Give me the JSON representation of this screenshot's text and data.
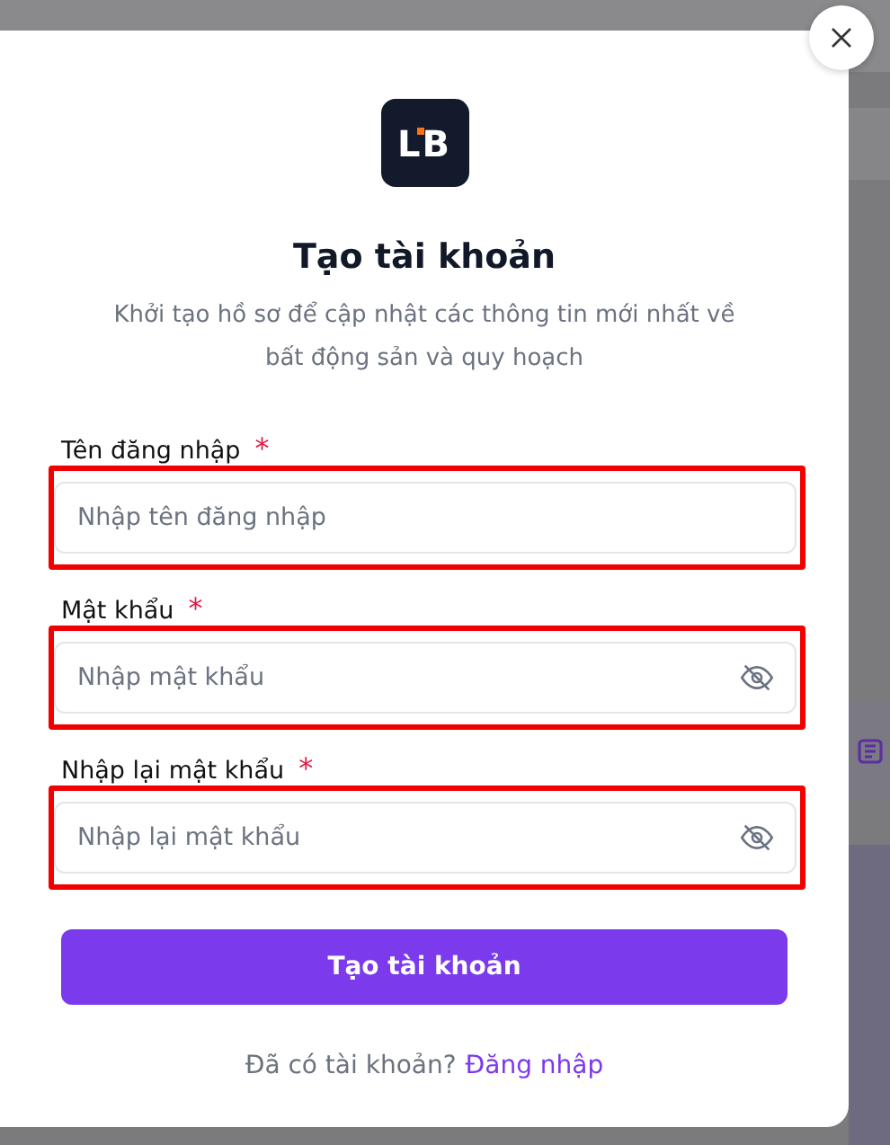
{
  "dialog": {
    "logo": "LB",
    "title": "Tạo tài khoản",
    "subtitle": "Khởi tạo hồ sơ để cập nhật các thông tin mới nhất về bất động sản và quy hoạch",
    "fields": [
      {
        "label": "Tên đăng nhập",
        "required_mark": "*",
        "placeholder": "Nhập tên đăng nhập",
        "kind": "text",
        "highlighted": true
      },
      {
        "label": "Mật khẩu",
        "required_mark": "*",
        "placeholder": "Nhập mật khẩu",
        "kind": "password",
        "highlighted": true
      },
      {
        "label": "Nhập lại mật khẩu",
        "required_mark": "*",
        "placeholder": "Nhập lại mật khẩu",
        "kind": "password",
        "highlighted": true
      }
    ],
    "submit": "Tạo tài khoản",
    "footer_text": "Đã có tài khoản?",
    "footer_link": "Đăng nhập"
  }
}
